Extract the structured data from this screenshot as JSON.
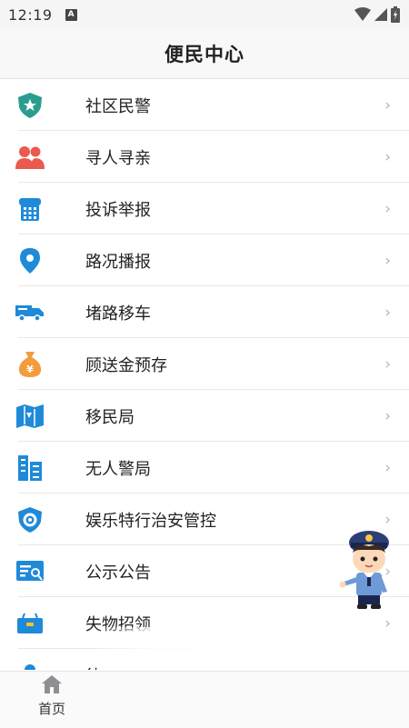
{
  "status_bar": {
    "time": "12:19",
    "notification": "A"
  },
  "header": {
    "title": "便民中心"
  },
  "menu": [
    {
      "label": "社区民警",
      "icon": "police-shield-icon"
    },
    {
      "label": "寻人寻亲",
      "icon": "people-icon"
    },
    {
      "label": "投诉举报",
      "icon": "phone-icon"
    },
    {
      "label": "路况播报",
      "icon": "location-pin-icon"
    },
    {
      "label": "堵路移车",
      "icon": "truck-icon"
    },
    {
      "label": "顾送金预存",
      "icon": "money-bag-icon"
    },
    {
      "label": "移民局",
      "icon": "map-icon"
    },
    {
      "label": "无人警局",
      "icon": "building-icon"
    },
    {
      "label": "娱乐特行治安管控",
      "icon": "gear-shield-icon"
    },
    {
      "label": "公示公告",
      "icon": "id-card-icon"
    },
    {
      "label": "失物招领",
      "icon": "box-icon"
    },
    {
      "label": "待",
      "icon": "person-icon"
    }
  ],
  "tab_bar": {
    "home_label": "首页"
  },
  "colors": {
    "teal": "#2a9d8f",
    "red": "#ea5a4f",
    "blue": "#1f8ad8",
    "orange": "#f39c3c"
  }
}
